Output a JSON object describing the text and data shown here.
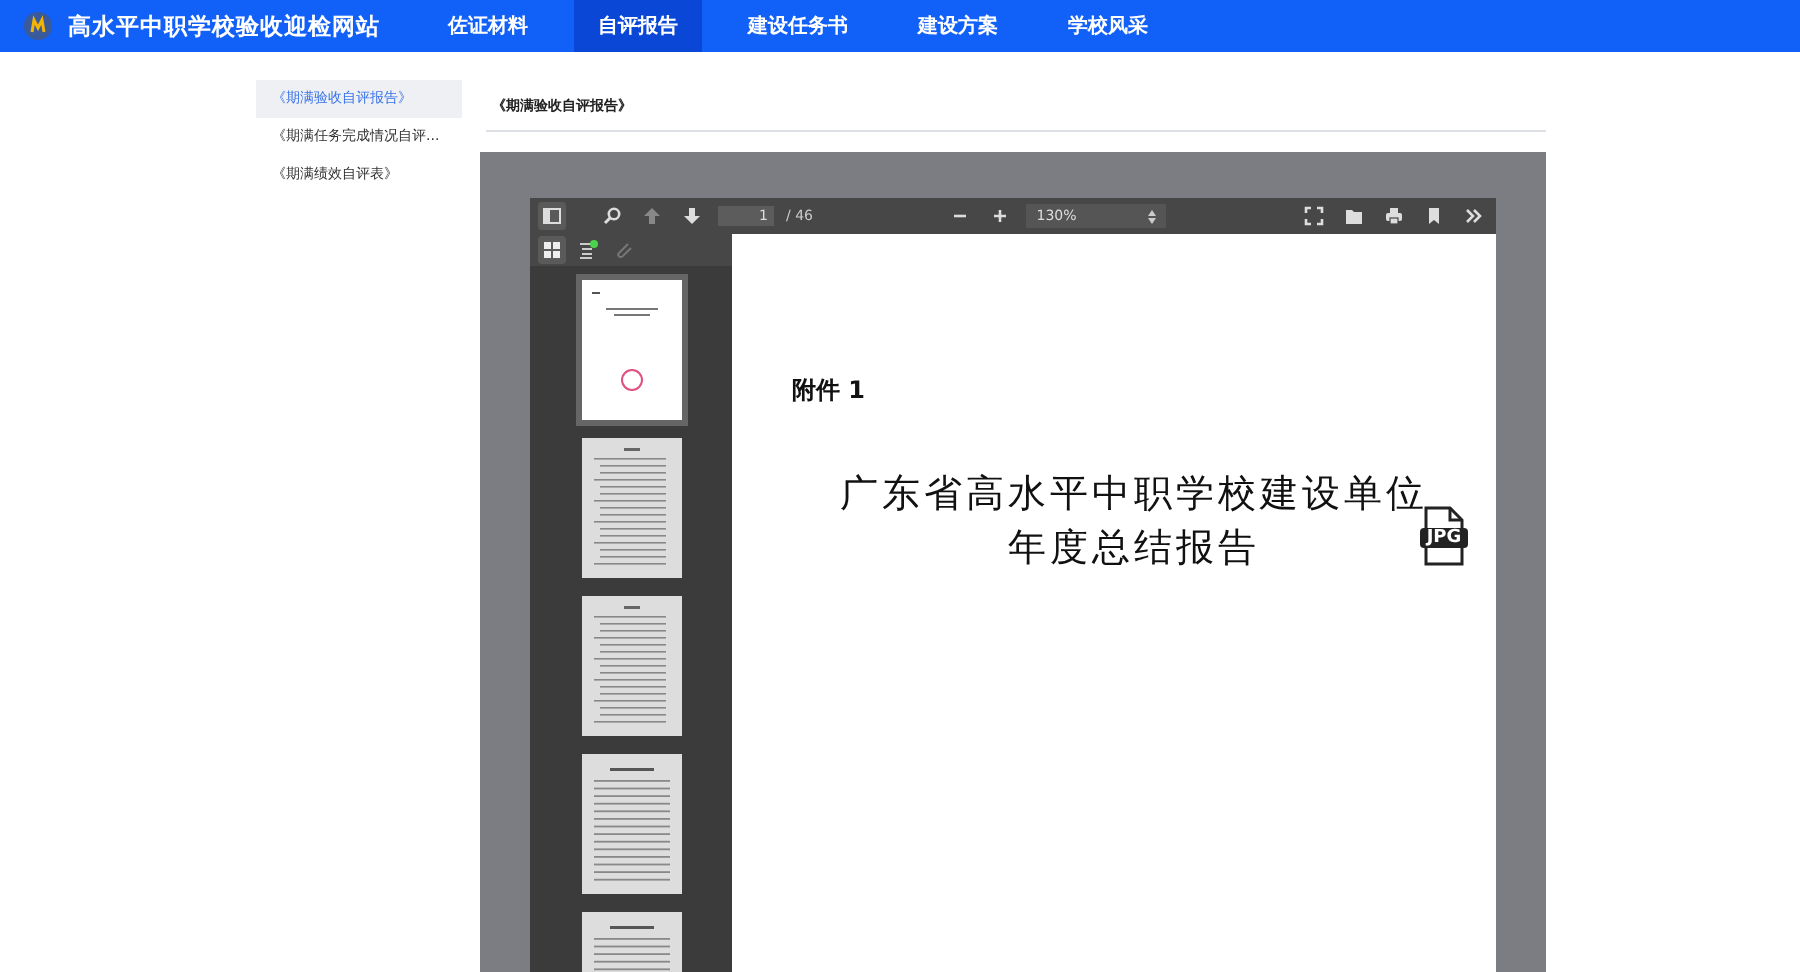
{
  "site": {
    "title": "高水平中职学校验收迎检网站"
  },
  "nav": [
    {
      "label": "佐证材料",
      "selected": false
    },
    {
      "label": "自评报告",
      "selected": true
    },
    {
      "label": "建设任务书",
      "selected": false
    },
    {
      "label": "建设方案",
      "selected": false
    },
    {
      "label": "学校风采",
      "selected": false
    }
  ],
  "sidebar": {
    "items": [
      {
        "label": "《期满验收自评报告》",
        "selected": true
      },
      {
        "label": "《期满任务完成情况自评...",
        "selected": false
      },
      {
        "label": "《期满绩效自评表》",
        "selected": false
      }
    ]
  },
  "content": {
    "heading": "《期满验收自评报告》"
  },
  "viewer": {
    "page_input": "1",
    "page_count": "/ 46",
    "zoom": "130%",
    "thumbnails": [
      {
        "selected": true,
        "kind": "cover"
      },
      {
        "selected": false,
        "kind": "toc"
      },
      {
        "selected": false,
        "kind": "toc"
      },
      {
        "selected": false,
        "kind": "text"
      },
      {
        "selected": false,
        "kind": "text"
      }
    ],
    "page": {
      "attachment": "附件 1",
      "title_lines": [
        "广东省高水平中职学校建设单位",
        "年度总结报告"
      ],
      "badge": "JPG"
    }
  }
}
